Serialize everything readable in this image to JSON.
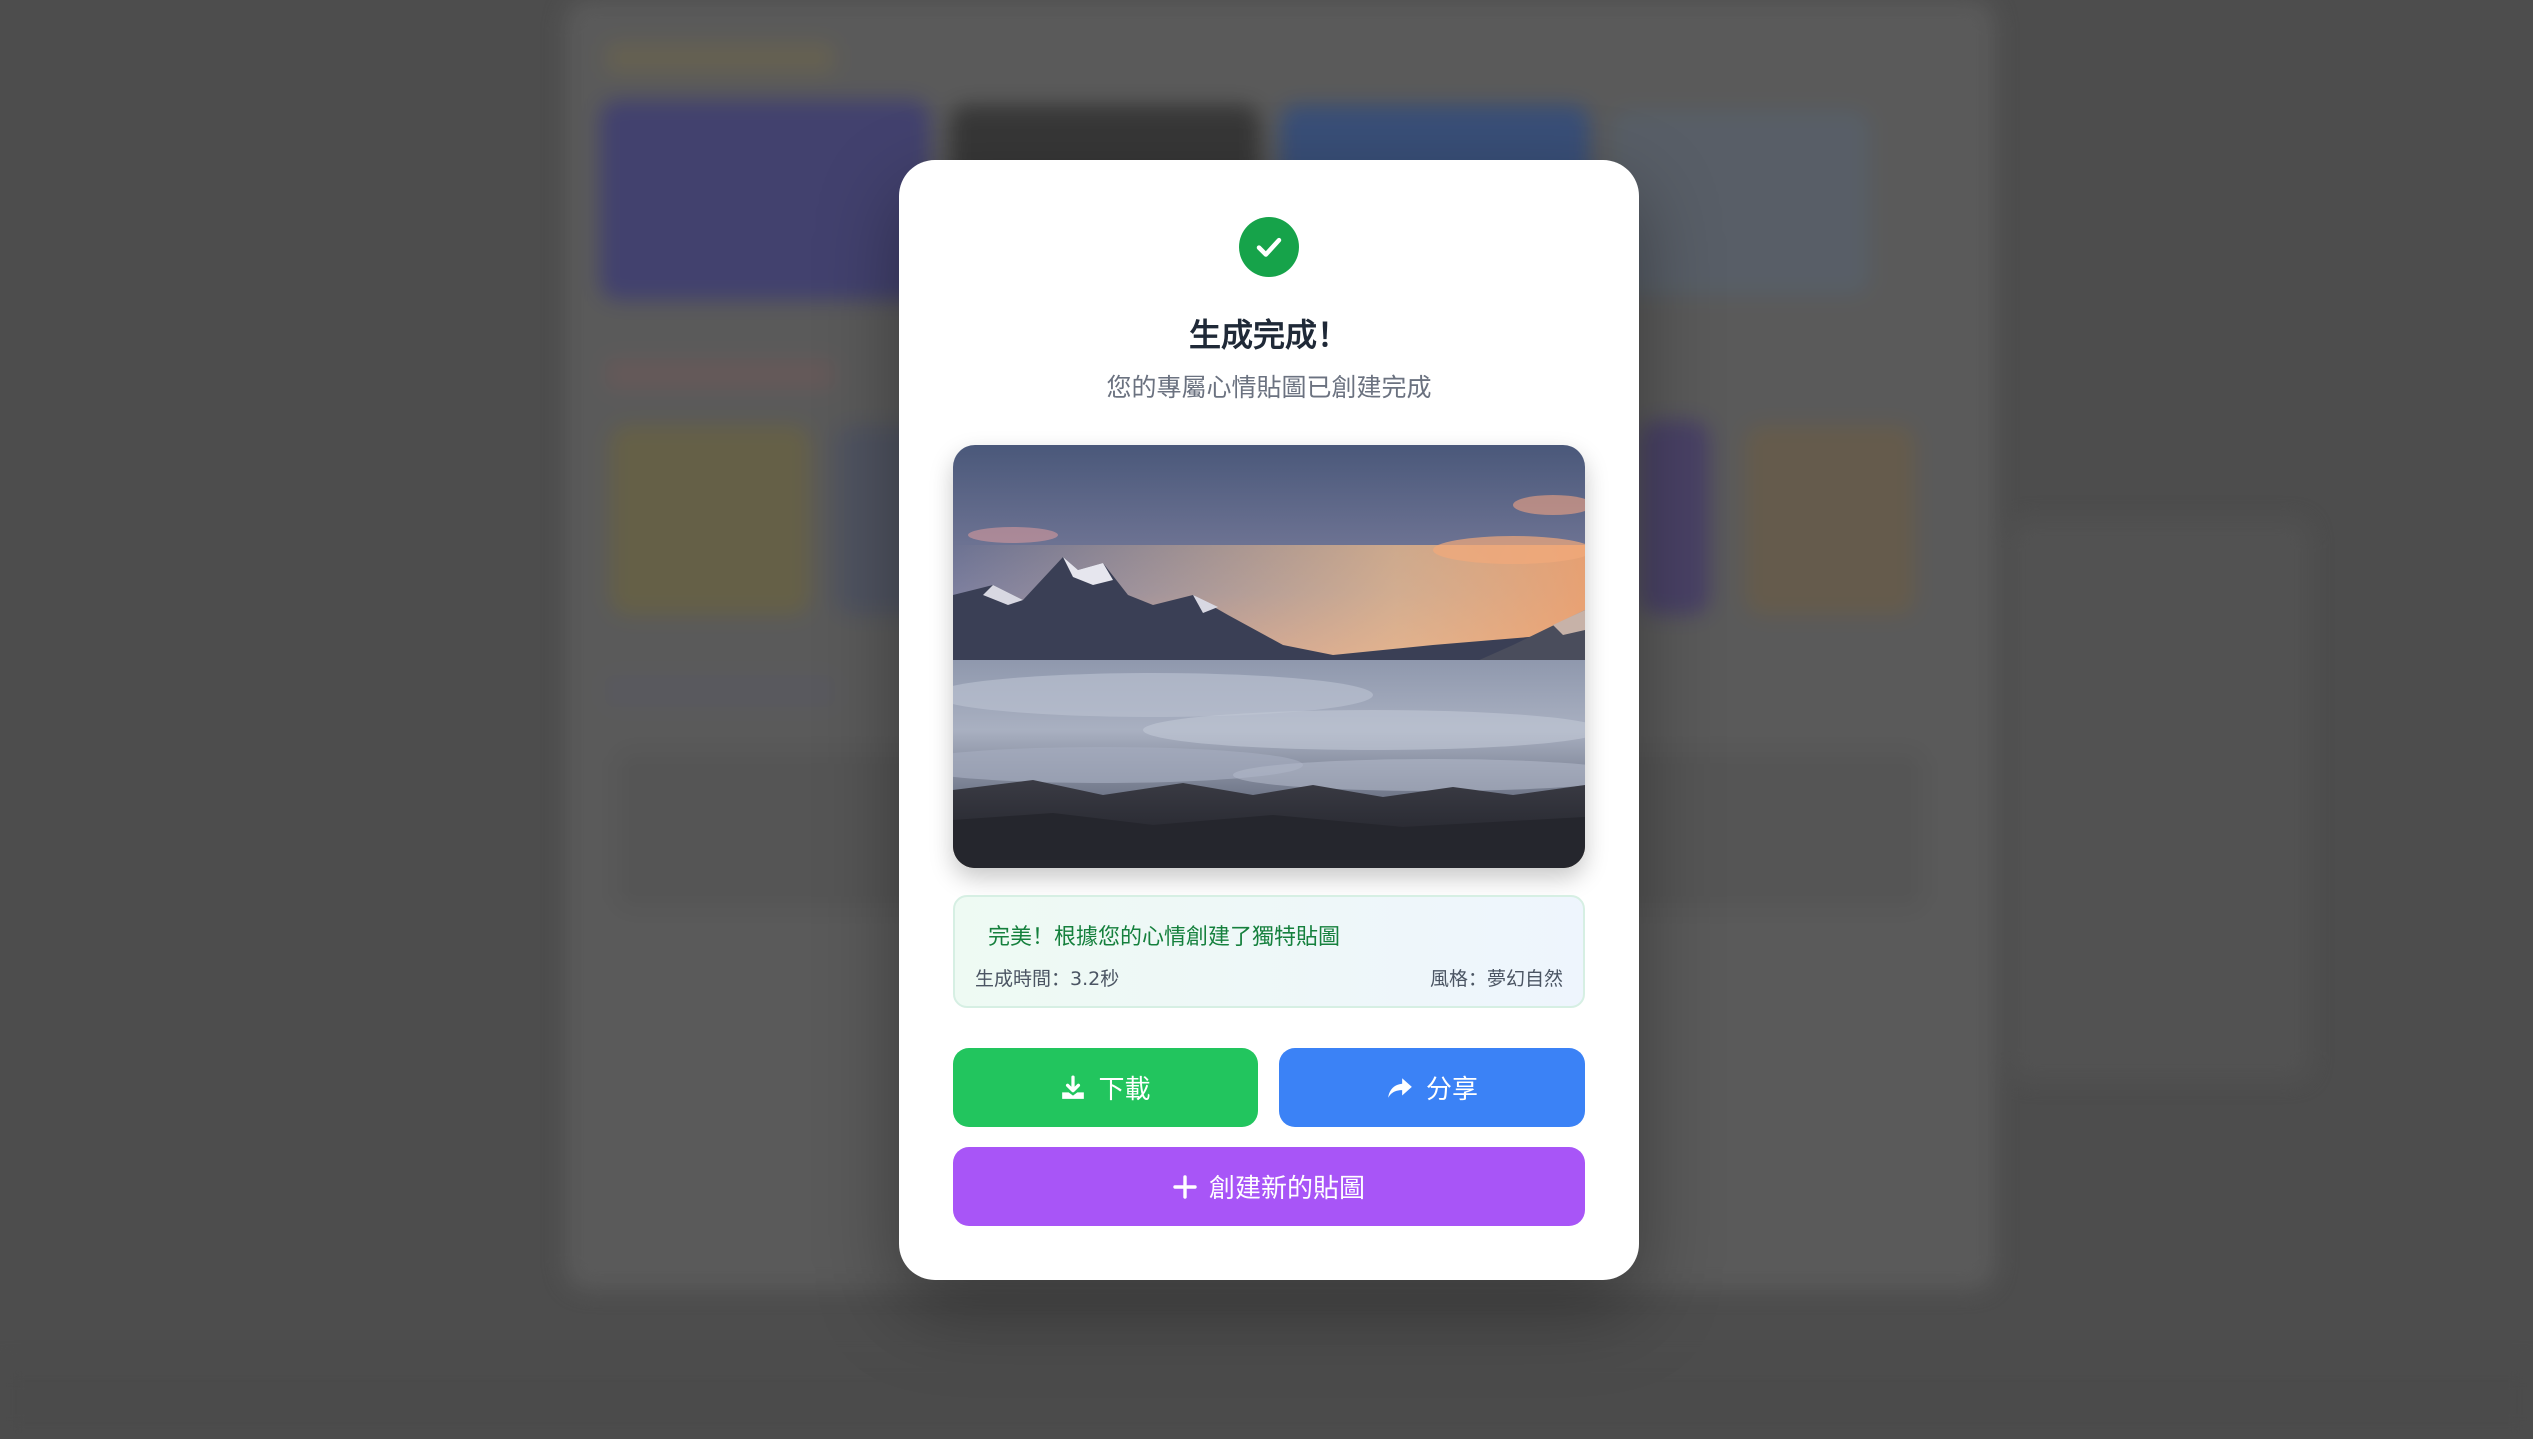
{
  "modal": {
    "title": "生成完成！",
    "subtitle": "您的專屬心情貼圖已創建完成",
    "image_alt": "雲海山景日落",
    "result": {
      "message": "完美！根據您的心情創建了獨特貼圖",
      "generation_time": "生成時間：3.2秒",
      "style": "風格：夢幻自然"
    },
    "buttons": {
      "download": "下載",
      "share": "分享",
      "create_new": "創建新的貼圖"
    },
    "icons": {
      "success": "check-circle-icon",
      "download": "download-icon",
      "share": "share-icon",
      "create": "plus-icon"
    }
  },
  "colors": {
    "success": "#16a34a",
    "download": "#22c55e",
    "share": "#3b82f6",
    "create": "#a855f7",
    "info_text": "#15803d"
  }
}
